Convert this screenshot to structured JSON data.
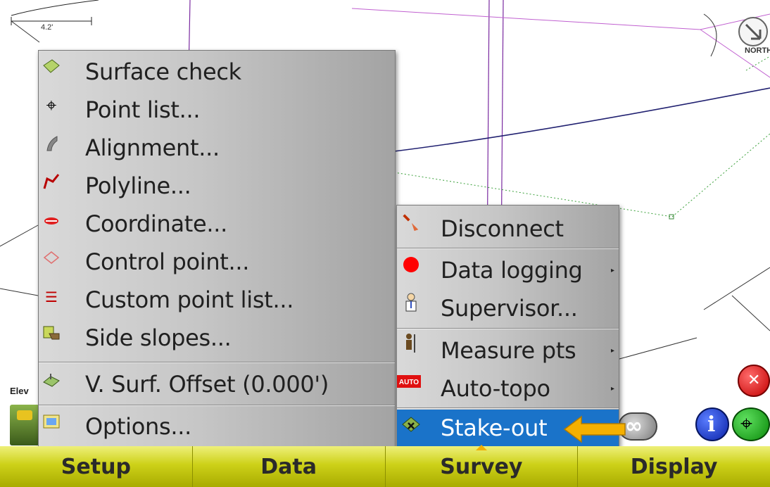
{
  "map": {
    "scale_label": "4.2'",
    "north_label": "NORTH",
    "elev_label": "Elev"
  },
  "data_menu": {
    "items": [
      {
        "label": "Surface check",
        "icon": "surface-check-icon"
      },
      {
        "label": "Point list...",
        "icon": "crosshair-icon"
      },
      {
        "label": "Alignment...",
        "icon": "alignment-icon"
      },
      {
        "label": "Polyline...",
        "icon": "polyline-icon"
      },
      {
        "label": "Coordinate...",
        "icon": "coordinate-icon"
      },
      {
        "label": "Control point...",
        "icon": "control-point-icon"
      },
      {
        "label": "Custom point list...",
        "icon": "list-icon"
      },
      {
        "label": "Side slopes...",
        "icon": "side-slopes-icon"
      },
      {
        "label": "V. Surf. Offset (0.000')",
        "icon": "surface-offset-icon"
      },
      {
        "label": "Options...",
        "icon": "options-icon"
      }
    ]
  },
  "survey_menu": {
    "items": [
      {
        "label": "Disconnect",
        "icon": "disconnect-icon",
        "submenu": false
      },
      {
        "label": "Data logging",
        "icon": "data-logging-icon",
        "submenu": true
      },
      {
        "label": "Supervisor...",
        "icon": "supervisor-icon",
        "submenu": false
      },
      {
        "label": "Measure pts",
        "icon": "measure-points-icon",
        "submenu": true
      },
      {
        "label": "Auto-topo",
        "icon": "auto-topo-icon",
        "submenu": true,
        "badge": "AUTO"
      },
      {
        "label": "Stake-out",
        "icon": "stake-out-icon",
        "submenu": false,
        "selected": true
      }
    ]
  },
  "bottom_bar": {
    "tabs": [
      "Setup",
      "Data",
      "Survey",
      "Display"
    ],
    "active_tab": "Survey"
  },
  "colors": {
    "selected": "#1a73c9",
    "bottom_bar": "#cdd118",
    "callout": "#f2b000"
  }
}
